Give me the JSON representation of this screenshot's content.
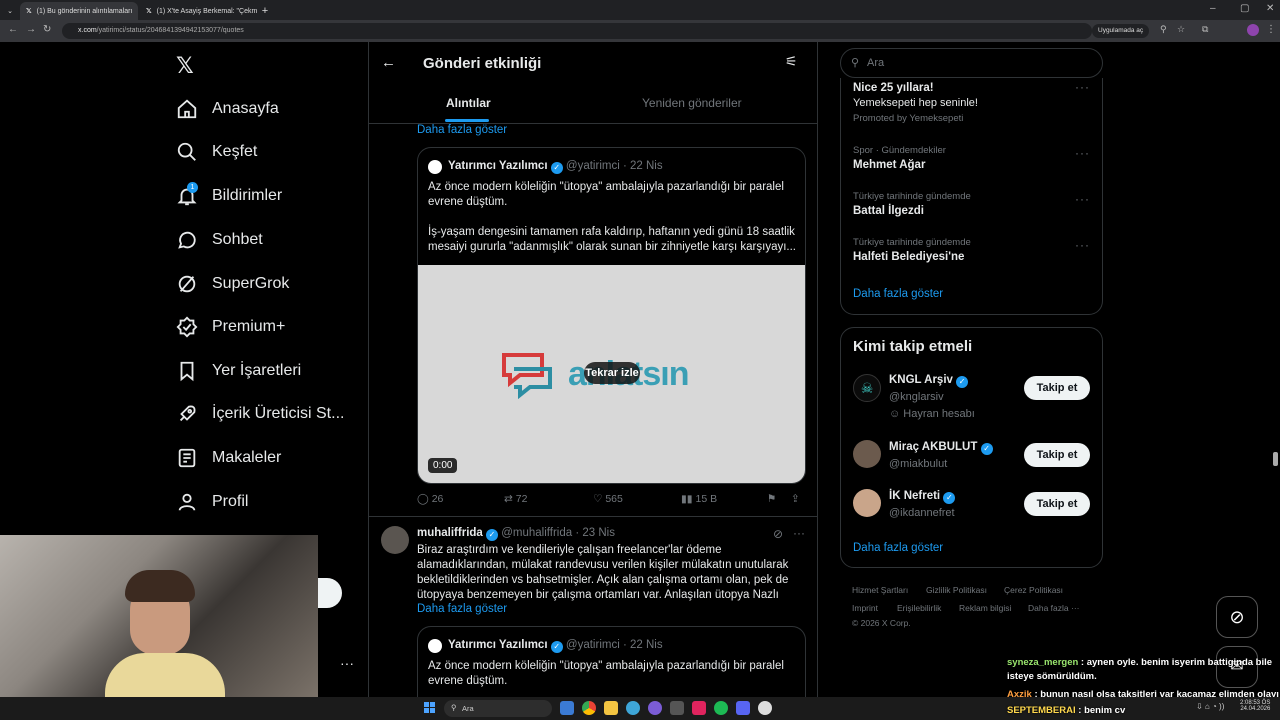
{
  "browser": {
    "tabs": [
      {
        "label": "(1) Bu gönderinin alıntılamaları"
      },
      {
        "label": "(1) X'te Asayiş Berkemal: \"Çekm"
      }
    ],
    "url_host": "x.com",
    "url_path": "/yatirimci/status/2046841394942153077/quotes",
    "app_chip": "Uygulamada aç"
  },
  "nav": {
    "items": [
      {
        "label": "Anasayfa",
        "icon": "home-icon"
      },
      {
        "label": "Keşfet",
        "icon": "search-icon"
      },
      {
        "label": "Bildirimler",
        "icon": "bell-icon",
        "badge": "1"
      },
      {
        "label": "Sohbet",
        "icon": "chat-icon"
      },
      {
        "label": "SuperGrok",
        "icon": "grok-icon"
      },
      {
        "label": "Premium+",
        "icon": "premium-icon"
      },
      {
        "label": "Yer İşaretleri",
        "icon": "bookmark-icon"
      },
      {
        "label": "İçerik Üreticisi St...",
        "icon": "rocket-icon"
      },
      {
        "label": "Makaleler",
        "icon": "article-icon"
      },
      {
        "label": "Profil",
        "icon": "profile-icon"
      }
    ]
  },
  "header": {
    "title": "Gönderi etkinliği",
    "tabs": [
      {
        "label": "Alıntılar",
        "active": true
      },
      {
        "label": "Yeniden gönderiler",
        "active": false
      }
    ]
  },
  "posts": {
    "show_more_top": "Daha fazla göster",
    "quoted1": {
      "name": "Yatırımcı Yazılımcı",
      "handle": "@yatirimci",
      "date": "· 22 Nis",
      "text1": "Az önce modern köleliğin \"ütopya\" ambalajıyla pazarlandığı bir paralel evrene düştüm.",
      "text2": "İş-yaşam dengesini tamamen rafa kaldırıp, haftanın yedi günü 18 saatlik mesaiyi gururla \"adanmışlık\" olarak sunan bir zihniyetle karşı karşıyayı...",
      "video_logo_text": "anlatsın",
      "replay": "Tekrar izle",
      "time": "0:00"
    },
    "actions": {
      "replies": "26",
      "retweets": "72",
      "likes": "565",
      "views": "15 B"
    },
    "post2": {
      "name": "muhaliffrida",
      "handle": "@muhaliffrida",
      "date": "· 23 Nis",
      "text": "Biraz araştırdım ve kendileriyle çalışan freelancer'lar ödeme alamadıklarından, mülakat randevusu verilen kişiler mülakatın unutularak bekletildiklerinden vs bahsetmişler. Açık alan çalışma ortamı olan, pek de ütopyaya benzemeyen bir çalışma ortamları var. Anlaşılan ütopya Nazlı",
      "show_more": "Daha fazla göster"
    },
    "quoted2": {
      "name": "Yatırımcı Yazılımcı",
      "handle": "@yatirimci",
      "date": "· 22 Nis",
      "text1": "Az önce modern köleliğin \"ütopya\" ambalajıyla pazarlandığı bir paralel evrene düştüm."
    }
  },
  "right": {
    "search_placeholder": "Ara",
    "promo": {
      "title": "Nice 25 yıllara!",
      "sub": "Yemeksepeti hep seninle!",
      "promoted": "Promoted by Yemeksepeti"
    },
    "trends": [
      {
        "cat": "Spor · Gündemdekiler",
        "name": "Mehmet Ağar"
      },
      {
        "cat": "Türkiye tarihinde gündemde",
        "name": "Battal İlgezdi"
      },
      {
        "cat": "Türkiye tarihinde gündemde",
        "name": "Halfeti Belediyesi'ne"
      }
    ],
    "trends_more": "Daha fazla göster",
    "who_title": "Kimi takip etmeli",
    "who": [
      {
        "name": "KNGL Arşiv",
        "handle": "@knglarsiv",
        "extra": "Hayran hesabı",
        "btn": "Takip et"
      },
      {
        "name": "Miraç AKBULUT",
        "handle": "@miakbulut",
        "btn": "Takip et"
      },
      {
        "name": "İK Nefreti",
        "handle": "@ikdannefret",
        "btn": "Takip et"
      }
    ],
    "who_more": "Daha fazla göster",
    "footer": [
      "Hizmet Şartları",
      "Gizlilik Politikası",
      "Çerez Politikası",
      "Imprint",
      "Erişilebilirlik",
      "Reklam bilgisi",
      "Daha fazla ···",
      "© 2026 X Corp."
    ]
  },
  "chat": [
    {
      "user": "syneza_mergen",
      "msg": " : aynen oyle. benim isyerim battiginda bile",
      "msg2": "isteye sömürüldüm.",
      "color": "#9ae66e"
    },
    {
      "user": "Axzik",
      "msg": " : bunun nasıl olsa taksitleri var kaçamaz elimden olayı",
      "color": "#ff9f40"
    },
    {
      "user": "SEPTEMBERAI",
      "msg": " : benim cv",
      "color": "#ffd84d"
    }
  ],
  "taskbar": {
    "search": "Ara",
    "time": "2:08:53 ÖS",
    "date": "24.04.2026"
  }
}
